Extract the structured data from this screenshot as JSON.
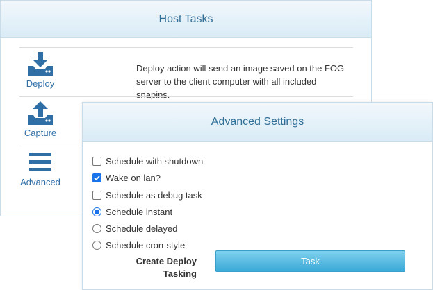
{
  "host_tasks": {
    "title": "Host Tasks",
    "tasks": [
      {
        "label": "Deploy",
        "icon": "deploy-icon",
        "description": "Deploy action will send an image saved on the FOG server to the client computer with all included snapins."
      },
      {
        "label": "Capture",
        "icon": "capture-icon",
        "description": ""
      },
      {
        "label": "Advanced",
        "icon": "advanced-menu-icon",
        "description": ""
      }
    ]
  },
  "advanced_settings": {
    "title": "Advanced Settings",
    "options": [
      {
        "label": "Schedule with shutdown",
        "type": "checkbox",
        "checked": false
      },
      {
        "label": "Wake on lan?",
        "type": "checkbox",
        "checked": true
      },
      {
        "label": "Schedule as debug task",
        "type": "checkbox",
        "checked": false
      },
      {
        "label": "Schedule instant",
        "type": "radio",
        "checked": true
      },
      {
        "label": "Schedule delayed",
        "type": "radio",
        "checked": false
      },
      {
        "label": "Schedule cron-style",
        "type": "radio",
        "checked": false
      }
    ],
    "create_label_line1": "Create Deploy",
    "create_label_line2": "Tasking",
    "task_button_label": "Task"
  },
  "colors": {
    "link": "#2f6fa6",
    "header_text": "#2f6e96",
    "button": "#3aa9d7",
    "checkbox_accent": "#1a73e8"
  }
}
